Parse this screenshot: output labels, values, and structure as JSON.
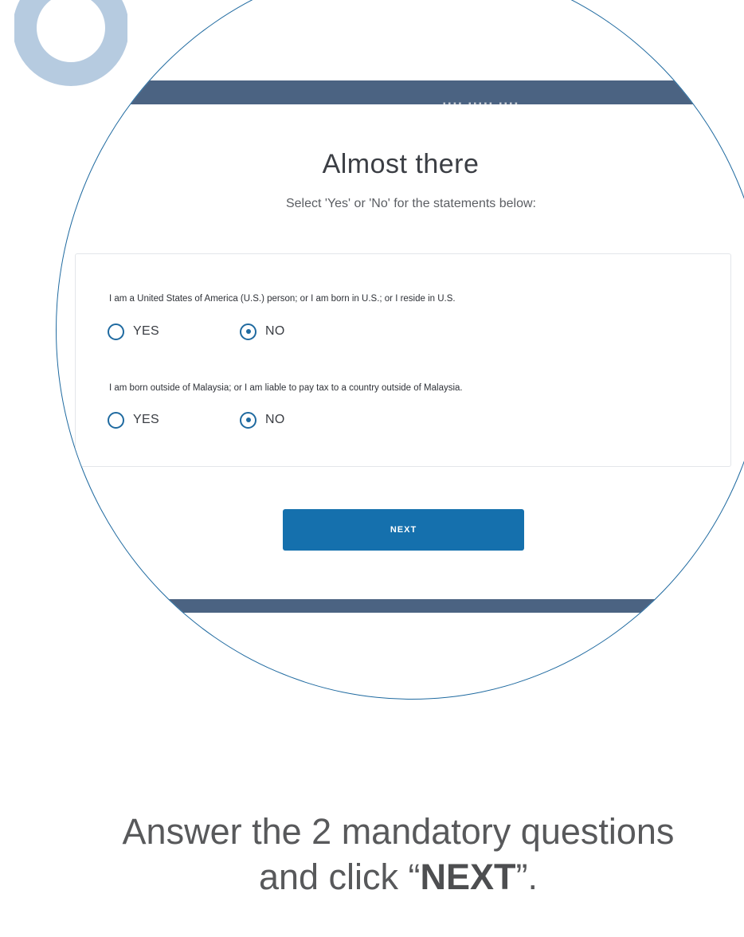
{
  "step_badge": {
    "shape": "circle-ring",
    "color": "#b6cbe0"
  },
  "screen": {
    "title": "Almost there",
    "subtitle": "Select 'Yes' or 'No' for the statements below:",
    "questions": [
      {
        "text": "I am a United States of America (U.S.) person; or I am born in U.S.; or I reside in U.S.",
        "options": [
          {
            "label": "YES",
            "selected": false
          },
          {
            "label": "NO",
            "selected": true
          }
        ]
      },
      {
        "text": "I am born outside of Malaysia; or I am liable to pay tax to a country outside of Malaysia.",
        "options": [
          {
            "label": "YES",
            "selected": false
          },
          {
            "label": "NO",
            "selected": true
          }
        ]
      }
    ],
    "next_button": "NEXT"
  },
  "caption": {
    "line1": "Answer the 2 mandatory questions",
    "line2_prefix": "and click “",
    "line2_emphasis": "NEXT",
    "line2_suffix": "”."
  },
  "colors": {
    "accent": "#1570ad",
    "header_bar": "#4b6382",
    "badge": "#b6cbe0"
  }
}
